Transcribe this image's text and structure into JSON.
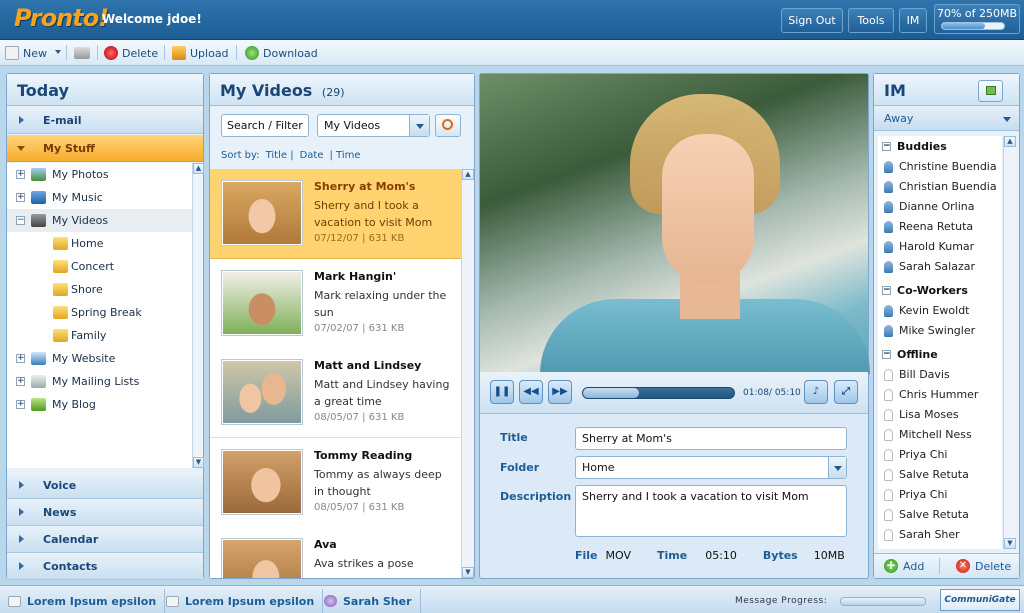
{
  "header": {
    "logo": "Pronto!",
    "welcome": "Welcome jdoe!",
    "buttons": [
      "Sign Out",
      "Tools",
      "IM"
    ],
    "quota_text": "70% of 250MB",
    "quota_fraction": 0.7
  },
  "toolbar": {
    "new": "New",
    "delete": "Delete",
    "upload": "Upload",
    "download": "Download"
  },
  "left": {
    "title": "Today",
    "nav_top": [
      "E-mail",
      "My Stuff"
    ],
    "tree": [
      {
        "label": "My Photos",
        "type": "root",
        "icon": "photos-icon"
      },
      {
        "label": "My Music",
        "type": "root",
        "icon": "music-icon"
      },
      {
        "label": "My Videos",
        "type": "root",
        "icon": "videos-icon",
        "selected": true
      },
      {
        "label": "Home",
        "type": "folder",
        "icon": "folder-icon"
      },
      {
        "label": "Concert",
        "type": "folder",
        "icon": "folder-icon"
      },
      {
        "label": "Shore",
        "type": "folder",
        "icon": "folder-icon"
      },
      {
        "label": "Spring Break",
        "type": "folder",
        "icon": "folder-icon"
      },
      {
        "label": "Family",
        "type": "folder",
        "icon": "folder-icon"
      },
      {
        "label": "My Website",
        "type": "root",
        "icon": "website-icon"
      },
      {
        "label": "My Mailing Lists",
        "type": "root",
        "icon": "mailing-list-icon"
      },
      {
        "label": "My Blog",
        "type": "root",
        "icon": "blog-icon"
      }
    ],
    "nav_bottom": [
      "Voice",
      "News",
      "Calendar",
      "Contacts"
    ]
  },
  "videos": {
    "title": "My Videos",
    "count": "(29)",
    "search_placeholder": "Search / Filter",
    "scope": "My Videos",
    "sort_label": "Sort by:",
    "sort_options": [
      "Title |",
      "Date",
      "| Time"
    ],
    "items": [
      {
        "title": "Sherry at Mom's",
        "desc": "Sherry and I took a vacation to visit Mom",
        "meta": "07/12/07 | 631 KB",
        "selected": true
      },
      {
        "title": "Mark Hangin'",
        "desc": "Mark relaxing under the sun",
        "meta": "07/02/07 | 631 KB"
      },
      {
        "title": "Matt and Lindsey",
        "desc": "Matt and Lindsey having a great time",
        "meta": "08/05/07 | 631 KB"
      },
      {
        "title": "Tommy Reading",
        "desc": "Tommy as always deep in thought",
        "meta": "08/05/07 | 631 KB"
      },
      {
        "title": "Ava",
        "desc": "Ava strikes a pose",
        "meta": ""
      }
    ]
  },
  "player": {
    "time": "01:08/ 05:10",
    "progress_fraction": 0.37,
    "title_label": "Title",
    "title_value": "Sherry at Mom's",
    "folder_label": "Folder",
    "folder_value": "Home",
    "desc_label": "Description",
    "desc_value": "Sherry and I took a vacation to visit Mom",
    "file_label": "File",
    "file_value": "MOV",
    "time_label": "Time",
    "time_value": "05:10",
    "bytes_label": "Bytes",
    "bytes_value": "10MB"
  },
  "im": {
    "title": "IM",
    "status": "Away",
    "groups": [
      {
        "name": "Buddies",
        "members": [
          {
            "name": "Christine Buendia",
            "online": true
          },
          {
            "name": "Christian Buendia",
            "online": true
          },
          {
            "name": "Dianne Orlina",
            "online": true
          },
          {
            "name": "Reena Retuta",
            "online": true
          },
          {
            "name": "Harold Kumar",
            "online": true
          },
          {
            "name": "Sarah Salazar",
            "online": true
          }
        ]
      },
      {
        "name": "Co-Workers",
        "members": [
          {
            "name": "Kevin Ewoldt",
            "online": true
          },
          {
            "name": "Mike Swingler",
            "online": true
          }
        ]
      },
      {
        "name": "Offline",
        "members": [
          {
            "name": "Bill Davis",
            "online": false
          },
          {
            "name": "Chris Hummer",
            "online": false
          },
          {
            "name": "Lisa Moses",
            "online": false
          },
          {
            "name": "Mitchell Ness",
            "online": false
          },
          {
            "name": "Priya Chi",
            "online": false
          },
          {
            "name": "Salve Retuta",
            "online": false
          },
          {
            "name": "Priya Chi",
            "online": false
          },
          {
            "name": "Salve Retuta",
            "online": false
          },
          {
            "name": "Sarah Sher",
            "online": false
          }
        ]
      }
    ],
    "add": "Add",
    "delete": "Delete"
  },
  "bottom": {
    "tabs": [
      "Lorem Ipsum epsilon",
      "Lorem Ipsum epsilon",
      "Sarah Sher"
    ],
    "message_progress": "Message Progress:",
    "brand": "CommuniGate Pro"
  }
}
